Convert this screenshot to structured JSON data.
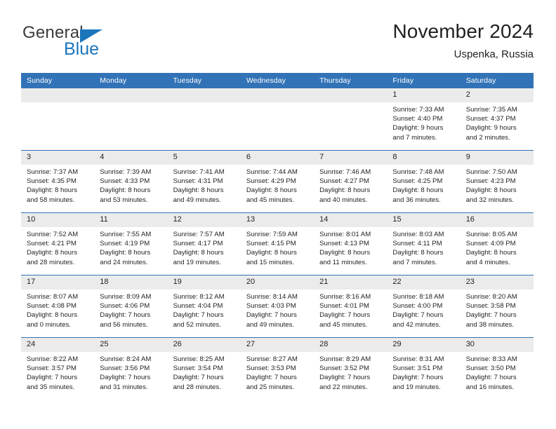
{
  "logo": {
    "word1": "General",
    "word2": "Blue",
    "triangle_color": "#1b75bb",
    "word1_color": "#3b3b3d",
    "word2_color": "#1b75bb"
  },
  "header": {
    "title": "November 2024",
    "location": "Uspenka, Russia"
  },
  "theme": {
    "header_bg": "#3273b7",
    "header_text": "#ffffff",
    "daynum_bg": "#ebebeb",
    "row_border": "#3273b7",
    "body_text": "#231f20"
  },
  "weekdays": [
    "Sunday",
    "Monday",
    "Tuesday",
    "Wednesday",
    "Thursday",
    "Friday",
    "Saturday"
  ],
  "labels": {
    "sunrise": "Sunrise:",
    "sunset": "Sunset:",
    "daylight": "Daylight:"
  },
  "weeks": [
    [
      {
        "day": "",
        "empty": true,
        "sunrise": "",
        "sunset": "",
        "daylight1": "",
        "daylight2": ""
      },
      {
        "day": "",
        "empty": true,
        "sunrise": "",
        "sunset": "",
        "daylight1": "",
        "daylight2": ""
      },
      {
        "day": "",
        "empty": true,
        "sunrise": "",
        "sunset": "",
        "daylight1": "",
        "daylight2": ""
      },
      {
        "day": "",
        "empty": true,
        "sunrise": "",
        "sunset": "",
        "daylight1": "",
        "daylight2": ""
      },
      {
        "day": "",
        "empty": true,
        "sunrise": "",
        "sunset": "",
        "daylight1": "",
        "daylight2": ""
      },
      {
        "day": "1",
        "empty": false,
        "sunrise": "Sunrise: 7:33 AM",
        "sunset": "Sunset: 4:40 PM",
        "daylight1": "Daylight: 9 hours",
        "daylight2": "and 7 minutes."
      },
      {
        "day": "2",
        "empty": false,
        "sunrise": "Sunrise: 7:35 AM",
        "sunset": "Sunset: 4:37 PM",
        "daylight1": "Daylight: 9 hours",
        "daylight2": "and 2 minutes."
      }
    ],
    [
      {
        "day": "3",
        "empty": false,
        "sunrise": "Sunrise: 7:37 AM",
        "sunset": "Sunset: 4:35 PM",
        "daylight1": "Daylight: 8 hours",
        "daylight2": "and 58 minutes."
      },
      {
        "day": "4",
        "empty": false,
        "sunrise": "Sunrise: 7:39 AM",
        "sunset": "Sunset: 4:33 PM",
        "daylight1": "Daylight: 8 hours",
        "daylight2": "and 53 minutes."
      },
      {
        "day": "5",
        "empty": false,
        "sunrise": "Sunrise: 7:41 AM",
        "sunset": "Sunset: 4:31 PM",
        "daylight1": "Daylight: 8 hours",
        "daylight2": "and 49 minutes."
      },
      {
        "day": "6",
        "empty": false,
        "sunrise": "Sunrise: 7:44 AM",
        "sunset": "Sunset: 4:29 PM",
        "daylight1": "Daylight: 8 hours",
        "daylight2": "and 45 minutes."
      },
      {
        "day": "7",
        "empty": false,
        "sunrise": "Sunrise: 7:46 AM",
        "sunset": "Sunset: 4:27 PM",
        "daylight1": "Daylight: 8 hours",
        "daylight2": "and 40 minutes."
      },
      {
        "day": "8",
        "empty": false,
        "sunrise": "Sunrise: 7:48 AM",
        "sunset": "Sunset: 4:25 PM",
        "daylight1": "Daylight: 8 hours",
        "daylight2": "and 36 minutes."
      },
      {
        "day": "9",
        "empty": false,
        "sunrise": "Sunrise: 7:50 AM",
        "sunset": "Sunset: 4:23 PM",
        "daylight1": "Daylight: 8 hours",
        "daylight2": "and 32 minutes."
      }
    ],
    [
      {
        "day": "10",
        "empty": false,
        "sunrise": "Sunrise: 7:52 AM",
        "sunset": "Sunset: 4:21 PM",
        "daylight1": "Daylight: 8 hours",
        "daylight2": "and 28 minutes."
      },
      {
        "day": "11",
        "empty": false,
        "sunrise": "Sunrise: 7:55 AM",
        "sunset": "Sunset: 4:19 PM",
        "daylight1": "Daylight: 8 hours",
        "daylight2": "and 24 minutes."
      },
      {
        "day": "12",
        "empty": false,
        "sunrise": "Sunrise: 7:57 AM",
        "sunset": "Sunset: 4:17 PM",
        "daylight1": "Daylight: 8 hours",
        "daylight2": "and 19 minutes."
      },
      {
        "day": "13",
        "empty": false,
        "sunrise": "Sunrise: 7:59 AM",
        "sunset": "Sunset: 4:15 PM",
        "daylight1": "Daylight: 8 hours",
        "daylight2": "and 15 minutes."
      },
      {
        "day": "14",
        "empty": false,
        "sunrise": "Sunrise: 8:01 AM",
        "sunset": "Sunset: 4:13 PM",
        "daylight1": "Daylight: 8 hours",
        "daylight2": "and 11 minutes."
      },
      {
        "day": "15",
        "empty": false,
        "sunrise": "Sunrise: 8:03 AM",
        "sunset": "Sunset: 4:11 PM",
        "daylight1": "Daylight: 8 hours",
        "daylight2": "and 7 minutes."
      },
      {
        "day": "16",
        "empty": false,
        "sunrise": "Sunrise: 8:05 AM",
        "sunset": "Sunset: 4:09 PM",
        "daylight1": "Daylight: 8 hours",
        "daylight2": "and 4 minutes."
      }
    ],
    [
      {
        "day": "17",
        "empty": false,
        "sunrise": "Sunrise: 8:07 AM",
        "sunset": "Sunset: 4:08 PM",
        "daylight1": "Daylight: 8 hours",
        "daylight2": "and 0 minutes."
      },
      {
        "day": "18",
        "empty": false,
        "sunrise": "Sunrise: 8:09 AM",
        "sunset": "Sunset: 4:06 PM",
        "daylight1": "Daylight: 7 hours",
        "daylight2": "and 56 minutes."
      },
      {
        "day": "19",
        "empty": false,
        "sunrise": "Sunrise: 8:12 AM",
        "sunset": "Sunset: 4:04 PM",
        "daylight1": "Daylight: 7 hours",
        "daylight2": "and 52 minutes."
      },
      {
        "day": "20",
        "empty": false,
        "sunrise": "Sunrise: 8:14 AM",
        "sunset": "Sunset: 4:03 PM",
        "daylight1": "Daylight: 7 hours",
        "daylight2": "and 49 minutes."
      },
      {
        "day": "21",
        "empty": false,
        "sunrise": "Sunrise: 8:16 AM",
        "sunset": "Sunset: 4:01 PM",
        "daylight1": "Daylight: 7 hours",
        "daylight2": "and 45 minutes."
      },
      {
        "day": "22",
        "empty": false,
        "sunrise": "Sunrise: 8:18 AM",
        "sunset": "Sunset: 4:00 PM",
        "daylight1": "Daylight: 7 hours",
        "daylight2": "and 42 minutes."
      },
      {
        "day": "23",
        "empty": false,
        "sunrise": "Sunrise: 8:20 AM",
        "sunset": "Sunset: 3:58 PM",
        "daylight1": "Daylight: 7 hours",
        "daylight2": "and 38 minutes."
      }
    ],
    [
      {
        "day": "24",
        "empty": false,
        "sunrise": "Sunrise: 8:22 AM",
        "sunset": "Sunset: 3:57 PM",
        "daylight1": "Daylight: 7 hours",
        "daylight2": "and 35 minutes."
      },
      {
        "day": "25",
        "empty": false,
        "sunrise": "Sunrise: 8:24 AM",
        "sunset": "Sunset: 3:56 PM",
        "daylight1": "Daylight: 7 hours",
        "daylight2": "and 31 minutes."
      },
      {
        "day": "26",
        "empty": false,
        "sunrise": "Sunrise: 8:25 AM",
        "sunset": "Sunset: 3:54 PM",
        "daylight1": "Daylight: 7 hours",
        "daylight2": "and 28 minutes."
      },
      {
        "day": "27",
        "empty": false,
        "sunrise": "Sunrise: 8:27 AM",
        "sunset": "Sunset: 3:53 PM",
        "daylight1": "Daylight: 7 hours",
        "daylight2": "and 25 minutes."
      },
      {
        "day": "28",
        "empty": false,
        "sunrise": "Sunrise: 8:29 AM",
        "sunset": "Sunset: 3:52 PM",
        "daylight1": "Daylight: 7 hours",
        "daylight2": "and 22 minutes."
      },
      {
        "day": "29",
        "empty": false,
        "sunrise": "Sunrise: 8:31 AM",
        "sunset": "Sunset: 3:51 PM",
        "daylight1": "Daylight: 7 hours",
        "daylight2": "and 19 minutes."
      },
      {
        "day": "30",
        "empty": false,
        "sunrise": "Sunrise: 8:33 AM",
        "sunset": "Sunset: 3:50 PM",
        "daylight1": "Daylight: 7 hours",
        "daylight2": "and 16 minutes."
      }
    ]
  ]
}
